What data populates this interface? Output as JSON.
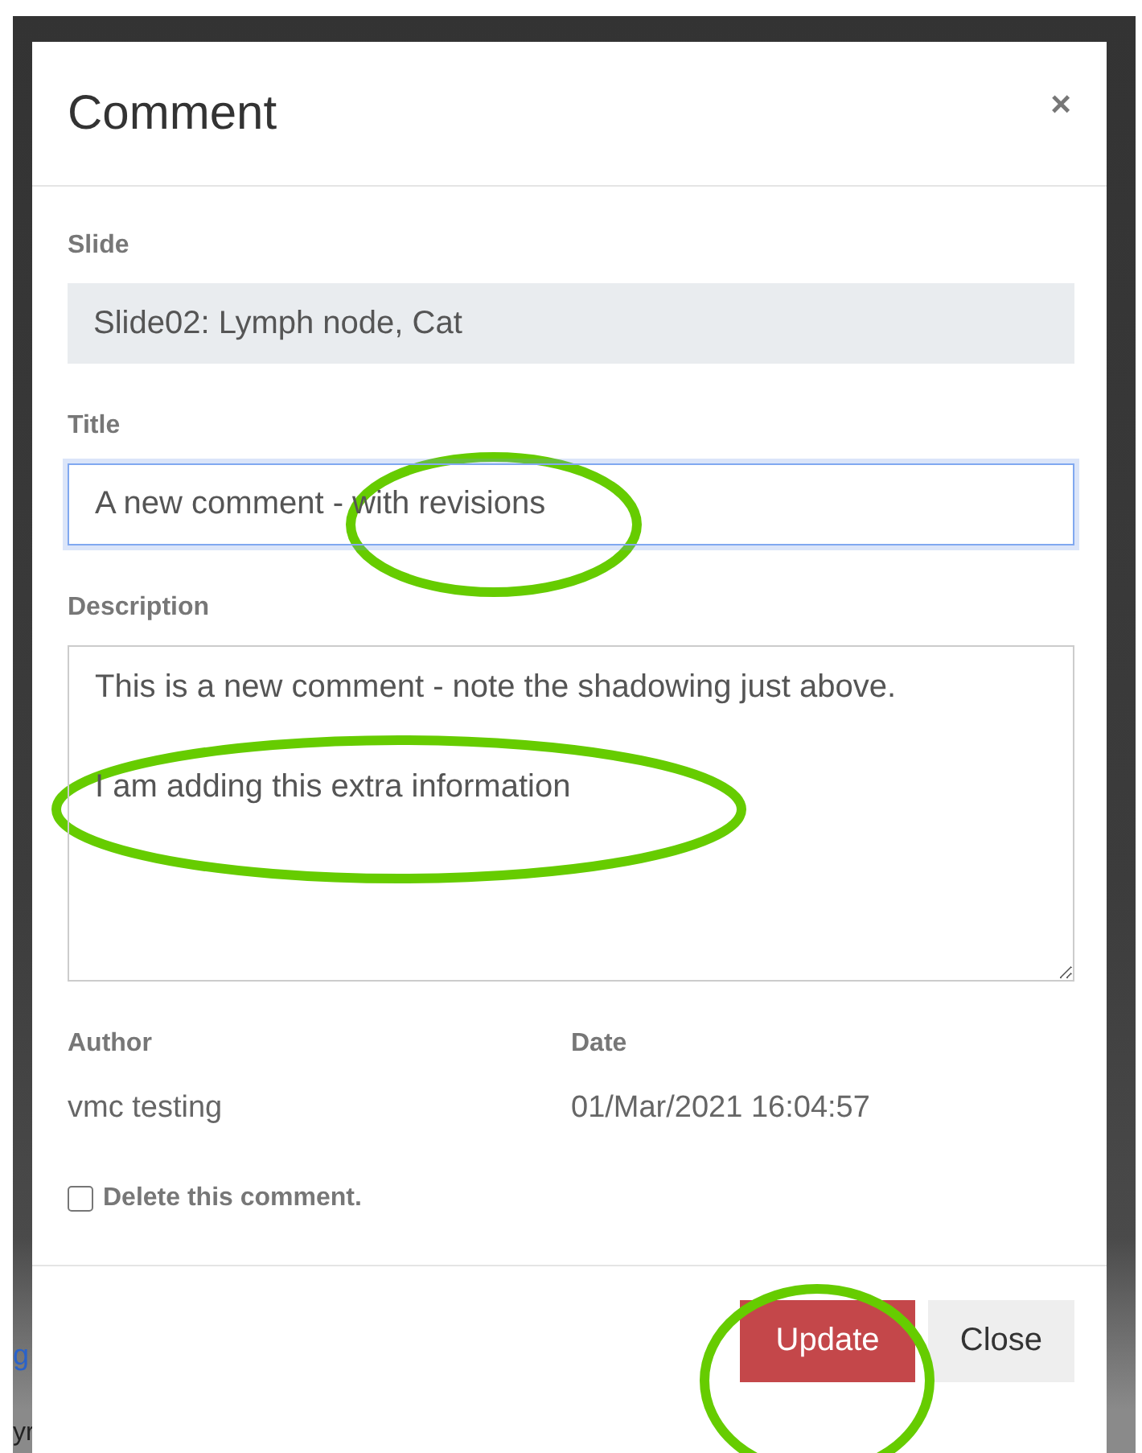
{
  "background_fragments": [
    {
      "kind": "link",
      "text": "g"
    },
    {
      "kind": "text",
      "text": "yr"
    }
  ],
  "dialog": {
    "title": "Comment",
    "close_icon": "×",
    "slide": {
      "label": "Slide",
      "value": "Slide02: Lymph node, Cat"
    },
    "title_field": {
      "label": "Title",
      "value": "A new comment - with revisions",
      "focused": true
    },
    "description": {
      "label": "Description",
      "value": "This is a new comment - note the shadowing just above.\n\nI am adding this extra information"
    },
    "author": {
      "label": "Author",
      "value": "vmc testing"
    },
    "date": {
      "label": "Date",
      "value": "01/Mar/2021 16:04:57"
    },
    "delete": {
      "label": "Delete this comment.",
      "checked": false
    },
    "buttons": [
      {
        "kind": "danger",
        "label": "Update"
      },
      {
        "kind": "default",
        "label": "Close"
      }
    ]
  }
}
